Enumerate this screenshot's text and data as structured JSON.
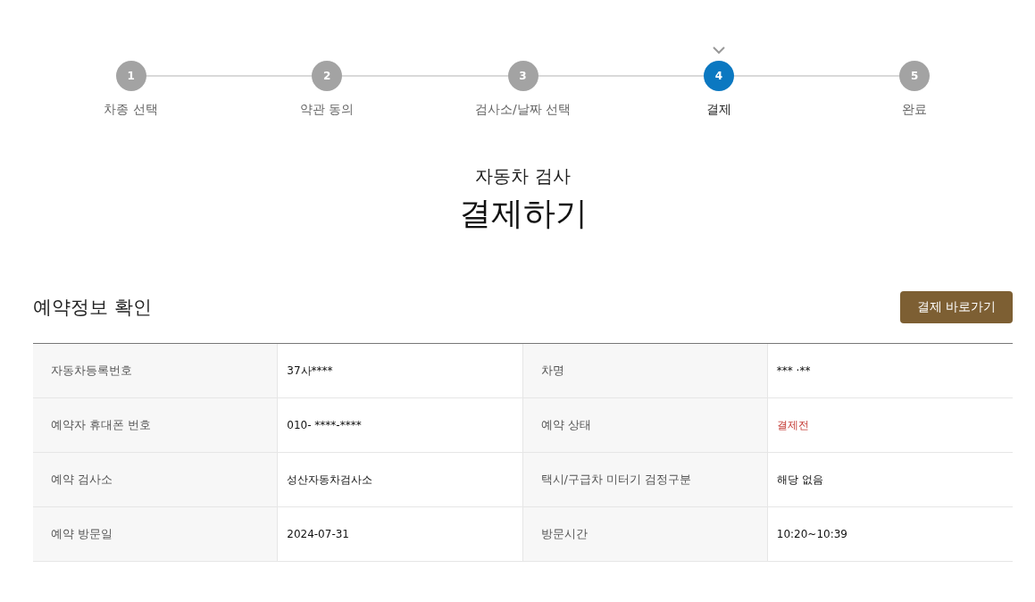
{
  "steps": [
    {
      "number": "1",
      "label": "차종 선택",
      "selected": false
    },
    {
      "number": "2",
      "label": "약관 동의",
      "selected": false
    },
    {
      "number": "3",
      "label": "검사소/날짜 선택",
      "selected": false
    },
    {
      "number": "4",
      "label": "결제",
      "selected": true
    },
    {
      "number": "5",
      "label": "완료",
      "selected": false
    }
  ],
  "heading": {
    "subtitle": "자동차 검사",
    "title": "결제하기"
  },
  "section": {
    "title": "예약정보 확인",
    "button": "결제 바로가기"
  },
  "table": {
    "rows": [
      {
        "cells": [
          {
            "label": "자동차등록번호",
            "value": "37사****",
            "kind": "plain"
          },
          {
            "label": "차명",
            "value": "*** ·**",
            "kind": "plain"
          }
        ]
      },
      {
        "cells": [
          {
            "label": "예약자 휴대폰 번호",
            "value": "010- ****-****",
            "kind": "plain"
          },
          {
            "label": "예약 상태",
            "value": "결제전",
            "kind": "alert"
          }
        ]
      },
      {
        "cells": [
          {
            "label": "예약 검사소",
            "value": "성산자동차검사소",
            "kind": "plain"
          },
          {
            "label": "택시/구급차 미터기 검정구분",
            "value": "해당 없음",
            "kind": "plain"
          }
        ]
      },
      {
        "cells": [
          {
            "label": "예약 방문일",
            "value": "2024-07-31",
            "kind": "plain"
          },
          {
            "label": "방문시간",
            "value": "10:20~10:39",
            "kind": "plain"
          }
        ]
      }
    ]
  }
}
